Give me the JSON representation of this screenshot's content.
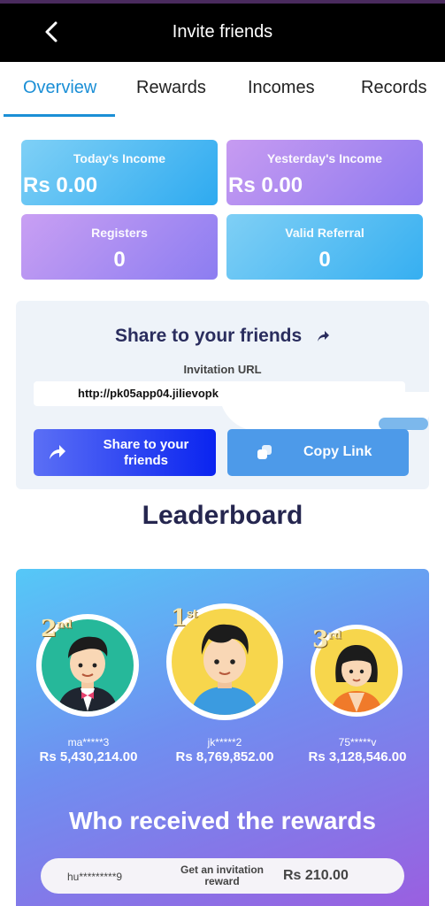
{
  "header": {
    "title": "Invite friends",
    "back_icon": "chevron-left-icon"
  },
  "tabs": [
    {
      "label": "Overview",
      "active": true
    },
    {
      "label": "Rewards",
      "active": false
    },
    {
      "label": "Incomes",
      "active": false
    },
    {
      "label": "Records",
      "active": false
    }
  ],
  "stats": {
    "today": {
      "label": "Today's Income",
      "value": "Rs 0.00"
    },
    "yesterday": {
      "label": "Yesterday's Income",
      "value": "Rs 0.00"
    },
    "registers": {
      "label": "Registers",
      "value": "0"
    },
    "valid_referral": {
      "label": "Valid Referral",
      "value": "0"
    }
  },
  "share": {
    "title": "Share to your friends",
    "invitation_label": "Invitation URL",
    "url": "http://pk05app04.jilievopk",
    "share_button": "Share to your friends",
    "copy_button": "Copy Link"
  },
  "leaderboard": {
    "title": "Leaderboard",
    "entries": [
      {
        "rank": "2",
        "suffix": "nd",
        "name": "ma*****3",
        "amount": "Rs 5,430,214.00"
      },
      {
        "rank": "1",
        "suffix": "st",
        "name": "jk*****2",
        "amount": "Rs 8,769,852.00"
      },
      {
        "rank": "3",
        "suffix": "rd",
        "name": "75*****v",
        "amount": "Rs 3,128,546.00"
      }
    ]
  },
  "rewards": {
    "title": "Who received the rewards",
    "rows": [
      {
        "user": "hu*********9",
        "desc": "Get an invitation reward",
        "amount": "Rs 210.00"
      }
    ]
  },
  "colors": {
    "accent": "#1b8fd6",
    "header_bg": "#000000",
    "title_navy": "#25264f"
  }
}
